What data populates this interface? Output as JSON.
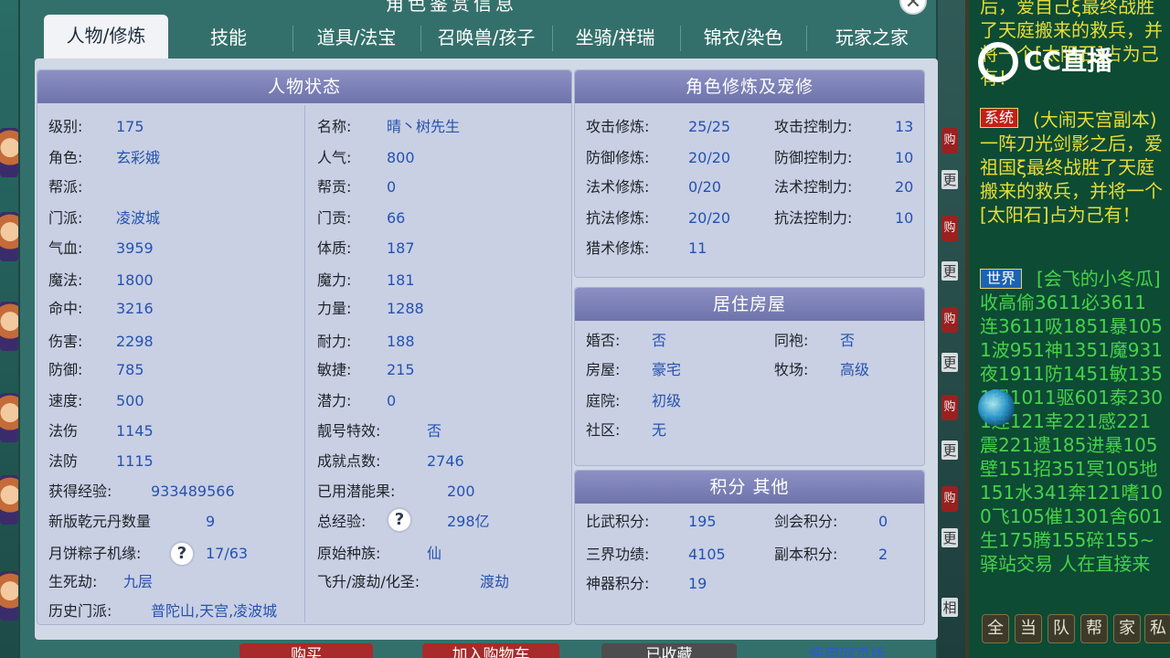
{
  "dialog": {
    "title": "角色鉴赏信息",
    "close": "✕"
  },
  "tabs": [
    "人物/修炼",
    "技能",
    "道具/法宝",
    "召唤兽/孩子",
    "坐骑/祥瑞",
    "锦衣/染色",
    "玩家之家"
  ],
  "status": {
    "header": "人物状态",
    "left": [
      {
        "label": "级别:",
        "value": "175"
      },
      {
        "label": "角色:",
        "value": "玄彩娥"
      },
      {
        "label": "帮派:",
        "value": ""
      },
      {
        "label": "门派:",
        "value": "凌波城"
      },
      {
        "label": "气血:",
        "value": "3959"
      },
      {
        "label": "魔法:",
        "value": "1800"
      },
      {
        "label": "命中:",
        "value": "3216"
      },
      {
        "label": "伤害:",
        "value": "2298"
      },
      {
        "label": "防御:",
        "value": "785"
      },
      {
        "label": "速度:",
        "value": "500"
      },
      {
        "label": "法伤",
        "value": "1145"
      },
      {
        "label": "法防",
        "value": "1115"
      },
      {
        "label": "获得经验:",
        "value": "933489566"
      },
      {
        "label": "新版乾元丹数量",
        "value": "9"
      },
      {
        "label": "月饼粽子机缘:",
        "value": "17/63"
      },
      {
        "label": "生死劫:",
        "value": "九层"
      },
      {
        "label": "历史门派:",
        "value": "普陀山,天宫,凌波城"
      }
    ],
    "right": [
      {
        "label": "名称:",
        "value": "晴丶树先生"
      },
      {
        "label": "人气:",
        "value": "800"
      },
      {
        "label": "帮贡:",
        "value": "0"
      },
      {
        "label": "门贡:",
        "value": "66"
      },
      {
        "label": "体质:",
        "value": "187"
      },
      {
        "label": "魔力:",
        "value": "181"
      },
      {
        "label": "力量:",
        "value": "1288"
      },
      {
        "label": "耐力:",
        "value": "188"
      },
      {
        "label": "敏捷:",
        "value": "215"
      },
      {
        "label": "潜力:",
        "value": "0"
      },
      {
        "label": "靓号特效:",
        "value": "否"
      },
      {
        "label": "成就点数:",
        "value": "2746"
      },
      {
        "label": "已用潜能果:",
        "value": "200"
      },
      {
        "label": "总经验:",
        "value": "298亿"
      },
      {
        "label": "原始种族:",
        "value": "仙"
      },
      {
        "label": "飞升/渡劫/化圣:",
        "value": "渡劫"
      }
    ],
    "help": "?"
  },
  "cultivation": {
    "header": "角色修炼及宠修",
    "left": [
      {
        "label": "攻击修炼:",
        "value": "25/25"
      },
      {
        "label": "防御修炼:",
        "value": "20/20"
      },
      {
        "label": "法术修炼:",
        "value": "0/20"
      },
      {
        "label": "抗法修炼:",
        "value": "20/20"
      },
      {
        "label": "猎术修炼:",
        "value": "11"
      }
    ],
    "right": [
      {
        "label": "攻击控制力:",
        "value": "13"
      },
      {
        "label": "防御控制力:",
        "value": "10"
      },
      {
        "label": "法术控制力:",
        "value": "20"
      },
      {
        "label": "抗法控制力:",
        "value": "10"
      }
    ]
  },
  "housing": {
    "header": "居住房屋",
    "left": [
      {
        "label": "婚否:",
        "value": "否"
      },
      {
        "label": "房屋:",
        "value": "豪宅"
      },
      {
        "label": "庭院:",
        "value": "初级"
      },
      {
        "label": "社区:",
        "value": "无"
      }
    ],
    "right": [
      {
        "label": "同袍:",
        "value": "否"
      },
      {
        "label": "牧场:",
        "value": "高级"
      }
    ]
  },
  "score": {
    "header": "积分 其他",
    "left": [
      {
        "label": "比武积分:",
        "value": "195"
      },
      {
        "label": "三界功绩:",
        "value": "4105"
      },
      {
        "label": "神器积分:",
        "value": "19"
      }
    ],
    "right": [
      {
        "label": "剑会积分:",
        "value": "0"
      },
      {
        "label": "副本积分:",
        "value": "2"
      }
    ]
  },
  "bottom_buttons": [
    "购买",
    "加入购物车",
    "已收藏",
    "使用网页版"
  ],
  "side": {
    "labels": [
      "购",
      "更",
      "更",
      "更",
      "更",
      "更",
      "相"
    ]
  },
  "chat": {
    "logo": "CC直播",
    "lines": [
      "后，爱自己ξ最终战胜了天庭搬来的救兵，并将一个[太阳石]占为己有！",
      "系统",
      "(大闹天宫副本)一阵刀光剑影之后，爱祖国ξ最终战胜了天庭搬来的救兵，并将一个[太阳石]占为己有！",
      "世界",
      "[会飞的小冬瓜]收高偷3611必3611连3611吸1851暴1051波951神1351魔931夜1911防1451敏1351强1011驱601泰2301连121幸221感221震221遗185进暴105壁151招351冥105地151水341奔121嗜100飞105催1301舍601生175腾155碎155~驿站交易 人在直接来"
    ],
    "channels": [
      "全",
      "当",
      "队",
      "帮",
      "家",
      "私"
    ]
  }
}
